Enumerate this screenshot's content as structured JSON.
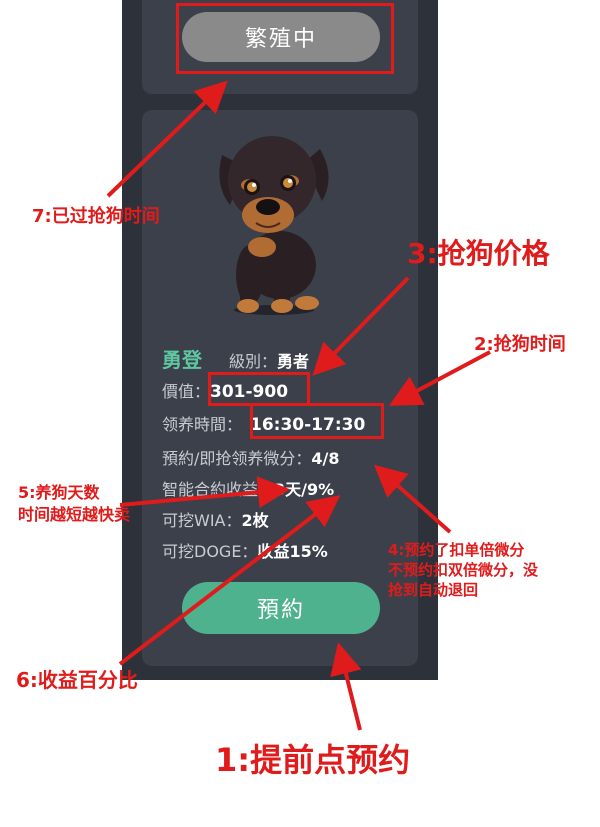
{
  "buttons": {
    "breeding": "繁殖中",
    "reserve": "預約"
  },
  "dog": {
    "name": "勇登",
    "level_label": "級別：",
    "level_value": "勇者",
    "price_label": "價值：",
    "price_value": "301-900",
    "time_label": "领养時間：",
    "time_value": "16:30-17:30",
    "reserve_label": "預約/即抢领养微分：",
    "reserve_value": "4/8",
    "contract_label": "智能合約收益：",
    "contract_value": "3天/9%",
    "wia_label": "可挖WIA：",
    "wia_value": "2枚",
    "doge_label": "可挖DOGE：",
    "doge_value": "收益15%"
  },
  "annotations": {
    "a7": "7:已过抢狗时间",
    "a3": "3:抢狗价格",
    "a2": "2:抢狗时间",
    "a5_line1": "5:养狗天数",
    "a5_line2": "时间越短越快卖",
    "a4_line1": "4:预约了扣单倍微分",
    "a4_line2": "不预约扣双倍微分，没",
    "a4_line3": "抢到自动退回",
    "a6": "6:收益百分比",
    "a1": "1:提前点预约"
  },
  "colors": {
    "accent_green": "#4fb28f",
    "annotation_red": "#e01b1b",
    "panel": "#3b404a"
  }
}
